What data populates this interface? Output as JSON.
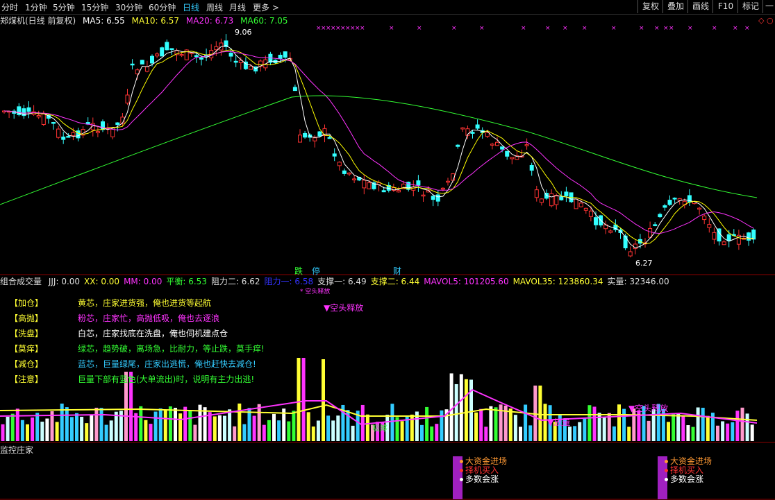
{
  "toolbar": {
    "timeframes": [
      "分时",
      "1分钟",
      "5分钟",
      "15分钟",
      "30分钟",
      "60分钟",
      "日线",
      "周线",
      "月线",
      "更多 >"
    ],
    "active": "日线",
    "right_buttons": [
      "复权",
      "叠加",
      "画线",
      "F10",
      "标记",
      "一七"
    ]
  },
  "chart_header": {
    "title": "郑煤机(日线 前复权)",
    "ma5": "MA5: 6.55",
    "ma10": "MA10: 6.57",
    "ma20": "MA20: 6.73",
    "ma60": "MA60: 7.05",
    "high_label": "9.06",
    "low_label": "6.27",
    "markers": [
      "跌",
      "停",
      "财"
    ]
  },
  "indicator": {
    "name": "组合成交量",
    "values": [
      "JJJ: 0.00",
      "XX: 0.00",
      "MM: 0.00",
      "平衡: 6.53",
      "阻力二: 6.62",
      "阻力一: 6.58",
      "支撑一: 6.49",
      "支撑二: 6.44",
      "MAVOL5: 101205.60",
      "MAVOL35: 123860.34",
      "实量: 32346.00"
    ],
    "value_colors": [
      "#ddd",
      "#ff3",
      "#f3f",
      "#3f3",
      "#ddd",
      "#33f",
      "#ddd",
      "#ff3",
      "#f3f",
      "#ff3",
      "#ddd"
    ],
    "kong_tou": "▼空头释放",
    "kong_tou_small": "* 空头释放",
    "xi_chou": "吸筹",
    "fang_xian": "▼放量"
  },
  "legend": [
    {
      "tag": "【加仓】",
      "text": "黄芯，庄家进货强，俺也进货等起航",
      "color": "#ff3"
    },
    {
      "tag": "【高抛】",
      "text": "粉芯，庄家忙，高抛低吸，俺也去逐浪",
      "color": "#f3f"
    },
    {
      "tag": "【洗盘】",
      "text": "白芯，庄家找底在洗盘，俺也伺机建点仓",
      "color": "#fff"
    },
    {
      "tag": "【莫痒】",
      "text": "绿芯，趋势破，离场急，比耐力，等止跌，莫手痒!",
      "color": "#3f3"
    },
    {
      "tag": "【减仓】",
      "text": "蓝芯，巨量绿尾，庄家出逃慌，俺也赶快去减仓!",
      "color": "#3cf"
    },
    {
      "tag": "【注意】",
      "text": "巨量下部有蓝色(大单流出)时，说明有主力出逃!",
      "color": "#3f3"
    }
  ],
  "monitor": {
    "title": "监控庄家",
    "signals": [
      "大资金进场",
      "择机买入",
      "多数会涨"
    ],
    "signal_colors": [
      "#f93",
      "#f33",
      "#fff"
    ]
  },
  "colors": {
    "up": "#ff3333",
    "down": "#33ffff",
    "ma5": "#ffffff",
    "ma10": "#ffff00",
    "ma20": "#ff33ff",
    "ma60": "#33ff33"
  }
}
